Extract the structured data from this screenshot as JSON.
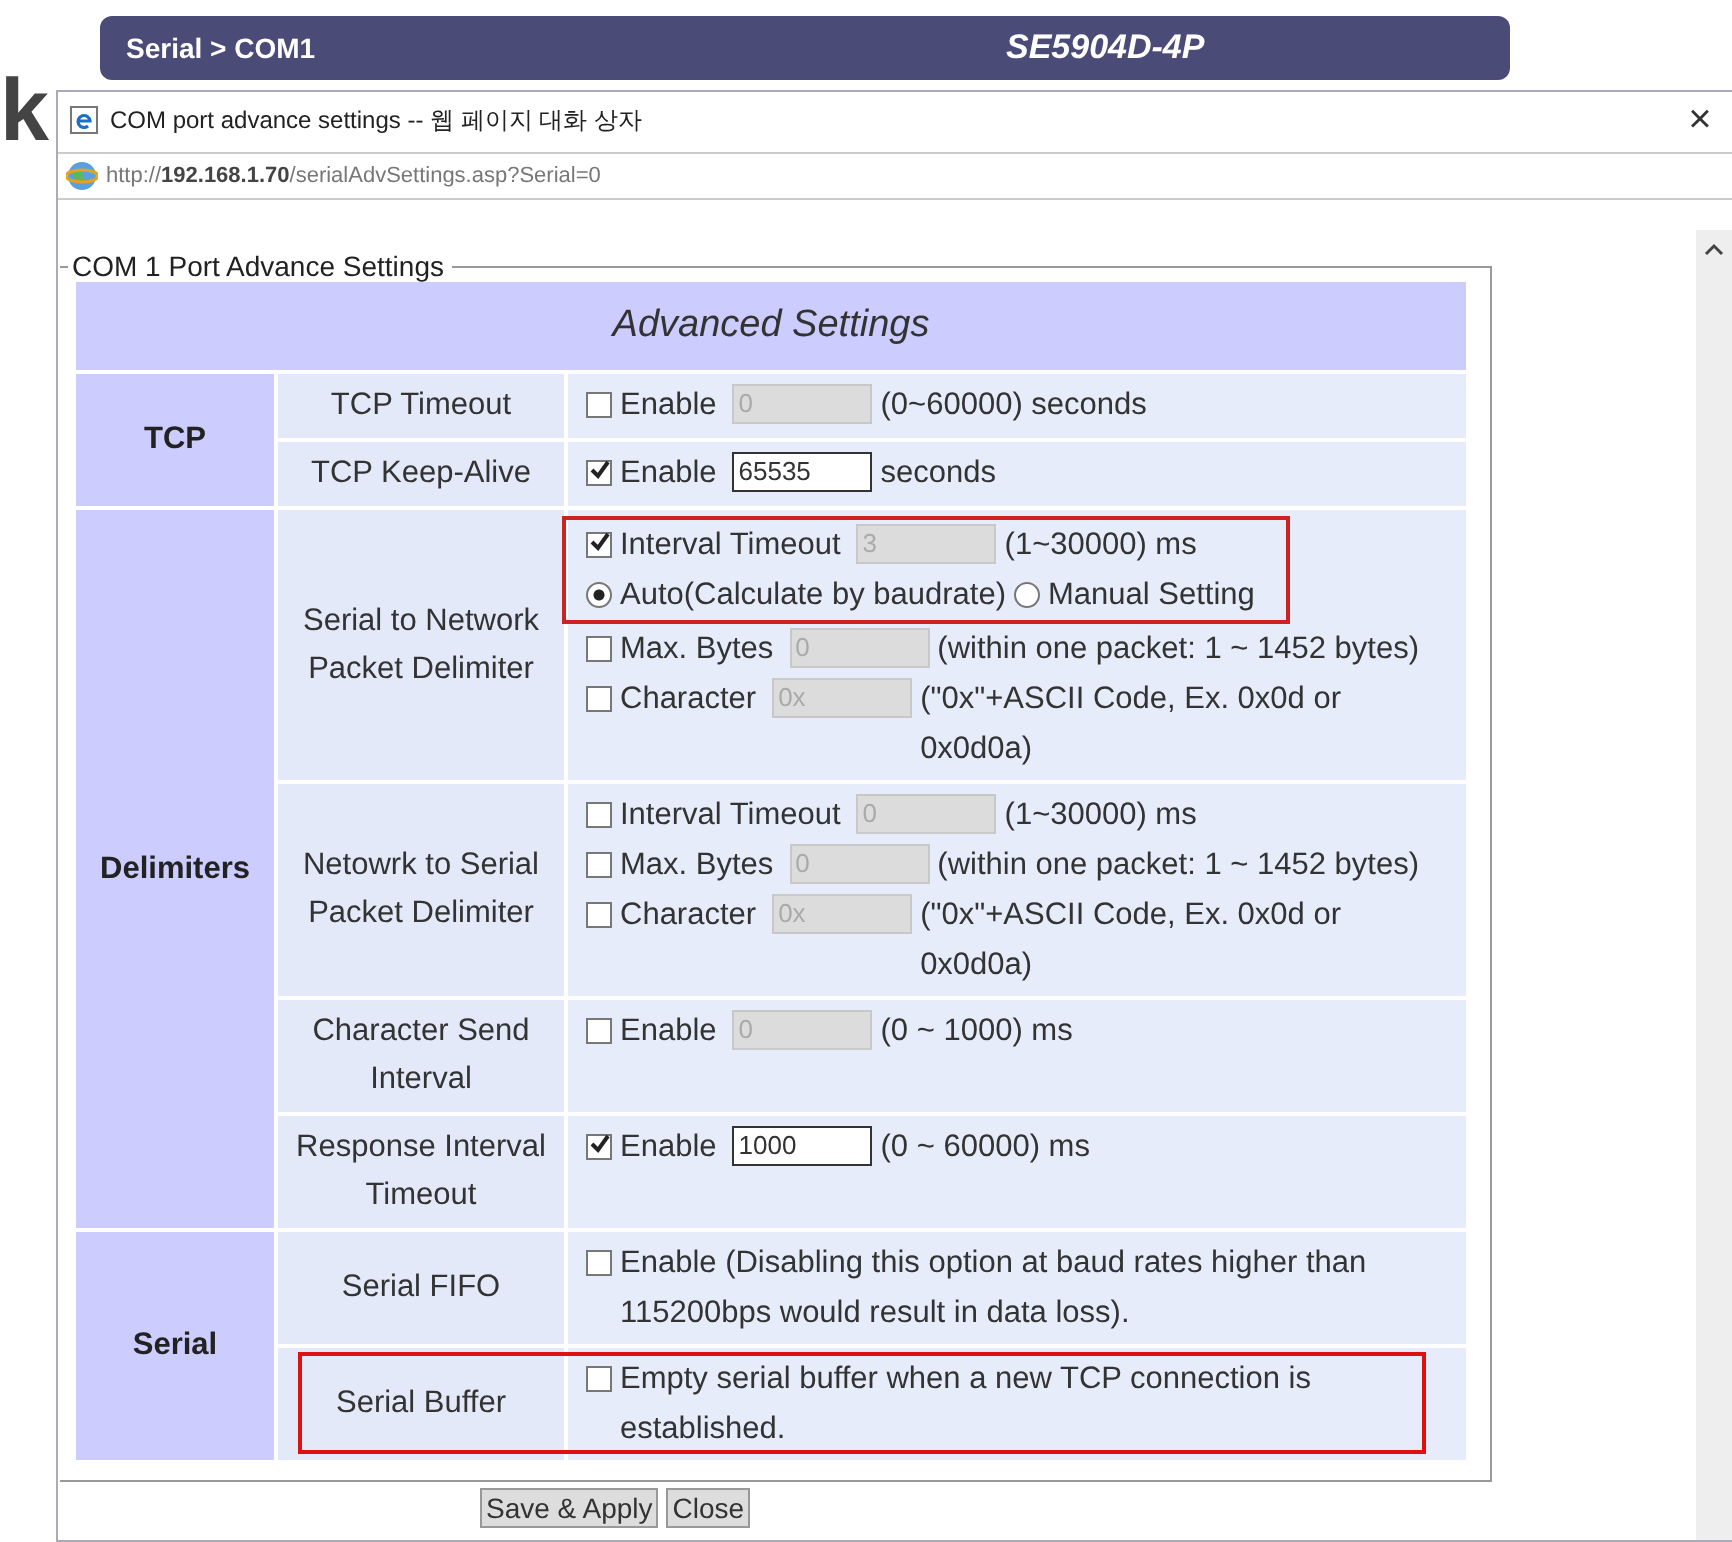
{
  "page_header": {
    "partial_letter": "k",
    "breadcrumb": "Serial > COM1",
    "model": "SE5904D-4P"
  },
  "dialog": {
    "title": "COM port advance settings -- 웹 페이지 대화 상자",
    "close": "×",
    "url": "http://**192.168.1.70**/serialAdvSettings.asp?Serial=0"
  },
  "fieldset_legend": "COM 1 Port Advance Settings",
  "table": {
    "title": "Advanced Settings",
    "sections": [
      {
        "label": "TCP",
        "rows": [
          {
            "label": "TCP Timeout",
            "highlighted": false,
            "lines": [
              {
                "highlighted": false,
                "items": [
                  {
                    "kind": "checkbox",
                    "label": "Enable",
                    "checked": false
                  },
                  {
                    "kind": "field",
                    "value": "0",
                    "disabled": true
                  },
                  {
                    "kind": "text",
                    "text": "(0~60000) seconds"
                  }
                ]
              }
            ]
          },
          {
            "label": "TCP Keep-Alive",
            "highlighted": false,
            "lines": [
              {
                "highlighted": false,
                "items": [
                  {
                    "kind": "checkbox",
                    "label": "Enable",
                    "checked": true
                  },
                  {
                    "kind": "field",
                    "value": "65535",
                    "disabled": false
                  },
                  {
                    "kind": "text",
                    "text": "seconds"
                  }
                ]
              }
            ]
          }
        ]
      },
      {
        "label": "Delimiters",
        "rows": [
          {
            "label": "Serial to Network Packet Delimiter",
            "highlighted": false,
            "lines": [
              {
                "highlighted": true,
                "items": [
                  {
                    "kind": "checkbox",
                    "label": "Interval Timeout",
                    "checked": true
                  },
                  {
                    "kind": "field",
                    "value": "3",
                    "disabled": true
                  },
                  {
                    "kind": "text",
                    "text": "(1~30000) ms"
                  }
                ]
              },
              {
                "highlighted": true,
                "items": [
                  {
                    "kind": "radio",
                    "label": "Auto(Calculate by baudrate)",
                    "selected": true
                  },
                  {
                    "kind": "radio",
                    "label": "Manual Setting",
                    "selected": false
                  }
                ]
              },
              {
                "highlighted": false,
                "items": [
                  {
                    "kind": "checkbox",
                    "label": "Max. Bytes",
                    "checked": false
                  },
                  {
                    "kind": "field",
                    "value": "0",
                    "disabled": true
                  },
                  {
                    "kind": "text",
                    "text": "(within one packet: 1 ~ 1452 bytes)"
                  }
                ]
              },
              {
                "highlighted": false,
                "items": [
                  {
                    "kind": "checkbox",
                    "label": "Character",
                    "checked": false
                  },
                  {
                    "kind": "field",
                    "value": "0x",
                    "disabled": true
                  },
                  {
                    "kind": "text",
                    "text": "(\"0x\"+ASCII Code, Ex. 0x0d or 0x0d0a)"
                  }
                ]
              }
            ]
          },
          {
            "label": "Netowrk to Serial Packet Delimiter",
            "highlighted": false,
            "lines": [
              {
                "highlighted": false,
                "items": [
                  {
                    "kind": "checkbox",
                    "label": "Interval Timeout",
                    "checked": false
                  },
                  {
                    "kind": "field",
                    "value": "0",
                    "disabled": true
                  },
                  {
                    "kind": "text",
                    "text": "(1~30000) ms"
                  }
                ]
              },
              {
                "highlighted": false,
                "items": [
                  {
                    "kind": "checkbox",
                    "label": "Max. Bytes",
                    "checked": false
                  },
                  {
                    "kind": "field",
                    "value": "0",
                    "disabled": true
                  },
                  {
                    "kind": "text",
                    "text": "(within one packet: 1 ~ 1452 bytes)"
                  }
                ]
              },
              {
                "highlighted": false,
                "items": [
                  {
                    "kind": "checkbox",
                    "label": "Character",
                    "checked": false
                  },
                  {
                    "kind": "field",
                    "value": "0x",
                    "disabled": true
                  },
                  {
                    "kind": "text",
                    "text": "(\"0x\"+ASCII Code, Ex. 0x0d or 0x0d0a)"
                  }
                ]
              }
            ]
          },
          {
            "label": "Character Send Interval",
            "highlighted": false,
            "lines": [
              {
                "highlighted": false,
                "items": [
                  {
                    "kind": "checkbox",
                    "label": "Enable",
                    "checked": false
                  },
                  {
                    "kind": "field",
                    "value": "0",
                    "disabled": true
                  },
                  {
                    "kind": "text",
                    "text": "(0 ~ 1000) ms"
                  }
                ]
              }
            ]
          },
          {
            "label": "Response Interval Timeout",
            "highlighted": false,
            "lines": [
              {
                "highlighted": false,
                "items": [
                  {
                    "kind": "checkbox",
                    "label": "Enable",
                    "checked": true
                  },
                  {
                    "kind": "field",
                    "value": "1000",
                    "disabled": false
                  },
                  {
                    "kind": "text",
                    "text": "(0 ~ 60000) ms"
                  }
                ]
              }
            ]
          }
        ]
      },
      {
        "label": "Serial",
        "rows": [
          {
            "label": "Serial FIFO",
            "highlighted": false,
            "lines": [
              {
                "highlighted": false,
                "items": [
                  {
                    "kind": "checkbox",
                    "label": "Enable (Disabling this option at baud rates higher than 115200bps would result in data loss).",
                    "checked": false
                  }
                ]
              }
            ]
          },
          {
            "label": "Serial Buffer",
            "highlighted": true,
            "lines": [
              {
                "highlighted": false,
                "items": [
                  {
                    "kind": "checkbox",
                    "label": "Empty serial buffer when a new TCP connection is established.",
                    "checked": false
                  }
                ]
              }
            ]
          }
        ]
      }
    ]
  },
  "buttons": [
    "Save & Apply",
    "Close"
  ]
}
